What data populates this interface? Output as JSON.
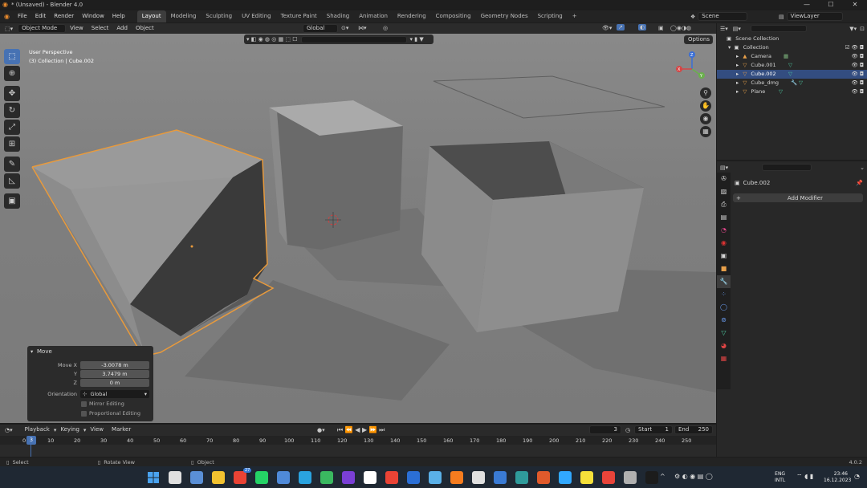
{
  "window": {
    "title": "* (Unsaved) - Blender 4.0",
    "controls": [
      "—",
      "☐",
      "✕"
    ]
  },
  "menu": [
    "File",
    "Edit",
    "Render",
    "Window",
    "Help"
  ],
  "workspaces": [
    "Layout",
    "Modeling",
    "Sculpting",
    "UV Editing",
    "Texture Paint",
    "Shading",
    "Animation",
    "Rendering",
    "Compositing",
    "Geometry Nodes",
    "Scripting"
  ],
  "active_workspace": "Layout",
  "scene": "Scene",
  "view_layer": "ViewLayer",
  "viewport_header": {
    "mode": "Object Mode",
    "menus": [
      "View",
      "Select",
      "Add",
      "Object"
    ],
    "orientation": "Global",
    "options_label": "Options"
  },
  "viewport_overlay": {
    "perspective": "User Perspective",
    "collection_info": "(3) Collection | Cube.002"
  },
  "gizmo_axes": [
    "X",
    "Y",
    "Z"
  ],
  "operator_panel": {
    "title": "Move",
    "fields": [
      {
        "label": "Move X",
        "value": "-3.0078 m"
      },
      {
        "label": "Y",
        "value": "3.7479 m"
      },
      {
        "label": "Z",
        "value": "0 m"
      }
    ],
    "orientation_label": "Orientation",
    "orientation_value": "Global",
    "mirror_label": "Mirror Editing",
    "proportional_label": "Proportional Editing"
  },
  "outliner": {
    "root": "Scene Collection",
    "collection": "Collection",
    "items": [
      {
        "name": "Camera",
        "selected": false
      },
      {
        "name": "Cube.001",
        "selected": false
      },
      {
        "name": "Cube.002",
        "selected": true
      },
      {
        "name": "Cube_dmg",
        "selected": false
      },
      {
        "name": "Plane",
        "selected": false
      }
    ]
  },
  "properties": {
    "object_name": "Cube.002",
    "add_modifier_label": "Add Modifier"
  },
  "timeline": {
    "menus": [
      "Playback",
      "Keying",
      "View",
      "Marker"
    ],
    "current_frame": "3",
    "start_label": "Start",
    "start_value": "1",
    "end_label": "End",
    "end_value": "250",
    "ruler": [
      "0",
      "10",
      "20",
      "30",
      "40",
      "50",
      "60",
      "70",
      "80",
      "90",
      "100",
      "110",
      "120",
      "130",
      "140",
      "150",
      "160",
      "170",
      "180",
      "190",
      "200",
      "210",
      "220",
      "230",
      "240",
      "250"
    ],
    "playhead_label": "3"
  },
  "statusbar": {
    "select": "Select",
    "rotate": "Rotate View",
    "object": "Object",
    "version": "4.0.2"
  },
  "taskbar": {
    "language_top": "ENG",
    "language_bottom": "INTL",
    "time": "23:46",
    "date": "16.12.2023",
    "badge": "27",
    "icon_colors": [
      "#3a7bd5",
      "#e0e0e0",
      "#5a8fd6",
      "#f2c230",
      "#ea4335",
      "#25d366",
      "#4f8ad9",
      "#2aa3e0",
      "#3ab860",
      "#7a3fd6",
      "#ffffff",
      "#ea4335",
      "#2b6fd6",
      "#5ab0e8",
      "#f57c1f",
      "#e0e0e0",
      "#3a7bd5",
      "#2f9b9b",
      "#e05a2b",
      "#31a8ff",
      "#f5e03a",
      "#e8443a",
      "#b0b0b0",
      "#1c1c1c"
    ]
  }
}
